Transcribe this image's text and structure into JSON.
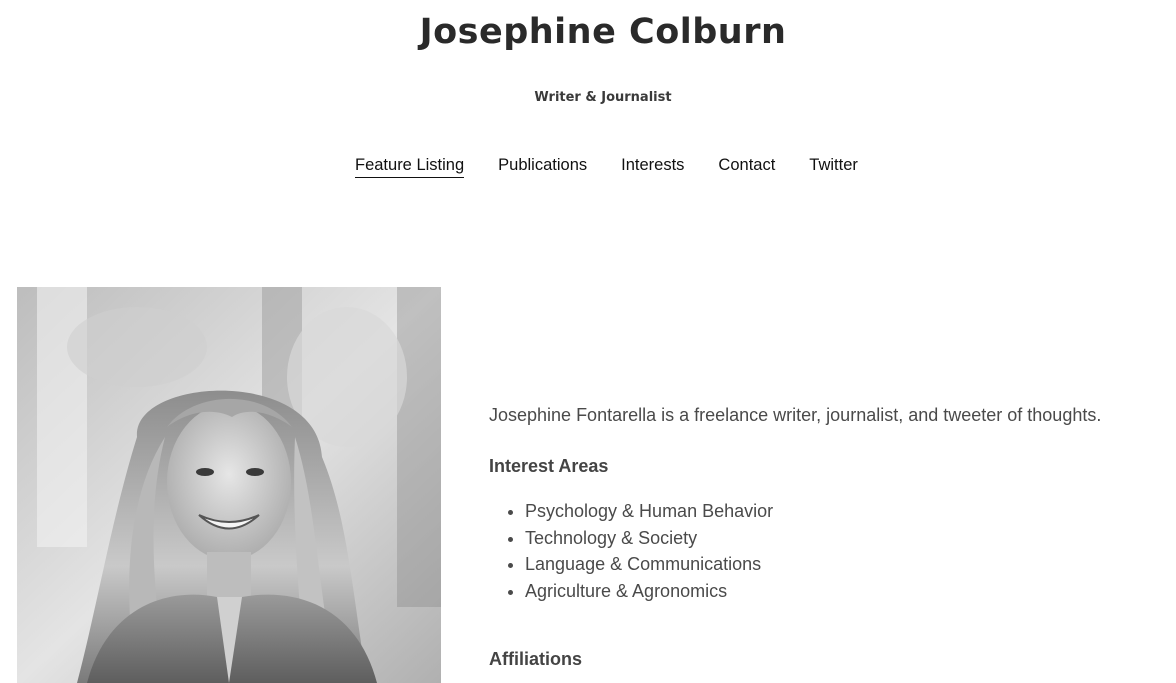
{
  "header": {
    "title": "Josephine Colburn",
    "tagline": "Writer & Journalist"
  },
  "nav": {
    "items": [
      {
        "label": "Feature Listing",
        "active": true
      },
      {
        "label": "Publications",
        "active": false
      },
      {
        "label": "Interests",
        "active": false
      },
      {
        "label": "Contact",
        "active": false
      },
      {
        "label": "Twitter",
        "active": false
      }
    ]
  },
  "bio": {
    "intro": "Josephine Fontarella is a freelance writer, journalist, and tweeter of thoughts.",
    "interest_heading": "Interest Areas",
    "interests": [
      "Psychology & Human Behavior",
      "Technology & Society",
      "Language & Communications",
      "Agriculture & Agronomics"
    ],
    "affiliations_heading": "Affiliations"
  },
  "portrait": {
    "style": "black-and-white photo"
  }
}
